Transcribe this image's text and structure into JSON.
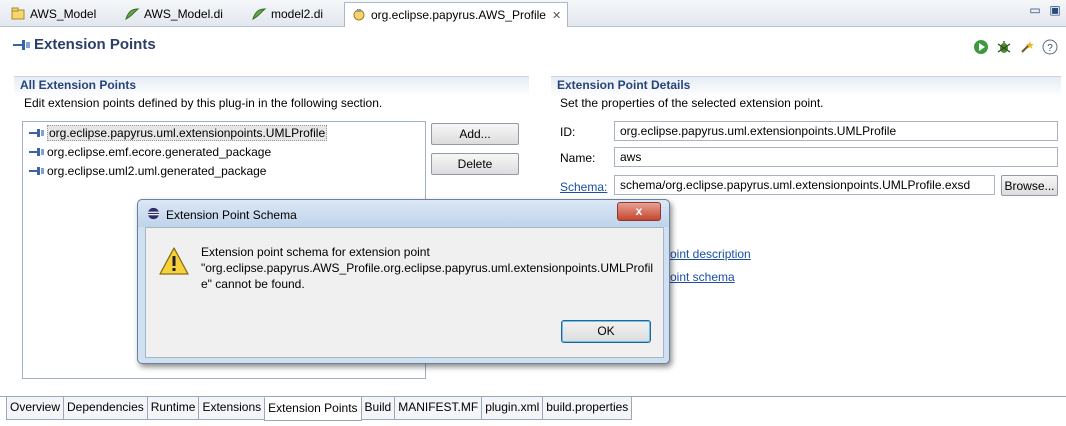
{
  "editor_tabs": [
    {
      "label": "AWS_Model",
      "icon": "uml-model-icon",
      "active": false
    },
    {
      "label": "AWS_Model.di",
      "icon": "papyrus-di-icon",
      "active": false
    },
    {
      "label": "model2.di",
      "icon": "papyrus-di-icon",
      "active": false
    },
    {
      "label": "org.eclipse.papyrus.AWS_Profile",
      "icon": "plugin-manifest-icon",
      "active": true,
      "close": "✕"
    }
  ],
  "form": {
    "title": "Extension Points",
    "toolbar_icons": [
      "run-icon",
      "debug-icon",
      "export-wizard-icon",
      "help-icon"
    ]
  },
  "all_extension_points": {
    "title": "All Extension Points",
    "description": "Edit extension points defined by this plug-in in the following section.",
    "items": [
      "org.eclipse.papyrus.uml.extensionpoints.UMLProfile",
      "org.eclipse.emf.ecore.generated_package",
      "org.eclipse.uml2.uml.generated_package"
    ],
    "selected_index": 0,
    "add_label": "Add...",
    "delete_label": "Delete"
  },
  "details": {
    "title": "Extension Point Details",
    "description": "Set the properties of the selected extension point.",
    "id_label": "ID:",
    "id_value": "org.eclipse.papyrus.uml.extensionpoints.UMLProfile",
    "name_label": "Name:",
    "name_value": "aws",
    "schema_label": "Schema:",
    "schema_value": "schema/org.eclipse.papyrus.uml.extensionpoints.UMLProfile.exsd",
    "browse_label": "Browse...",
    "link_description": "oint description",
    "link_schema": "oint schema"
  },
  "page_tabs": [
    "Overview",
    "Dependencies",
    "Runtime",
    "Extensions",
    "Extension Points",
    "Build",
    "MANIFEST.MF",
    "plugin.xml",
    "build.properties"
  ],
  "active_page_tab": "Extension Points",
  "dialog": {
    "title": "Extension Point Schema",
    "close": "x",
    "message_line1": "Extension point schema for extension point",
    "message_line2": "\"org.eclipse.papyrus.AWS_Profile.org.eclipse.papyrus.uml.extensionpoints.UMLProfil",
    "message_line3": "e\" cannot be found.",
    "ok_label": "OK"
  },
  "colors": {
    "section_title": "#25447c",
    "link": "#1a4fa3",
    "dialog_frame": "#cfe0f2"
  }
}
